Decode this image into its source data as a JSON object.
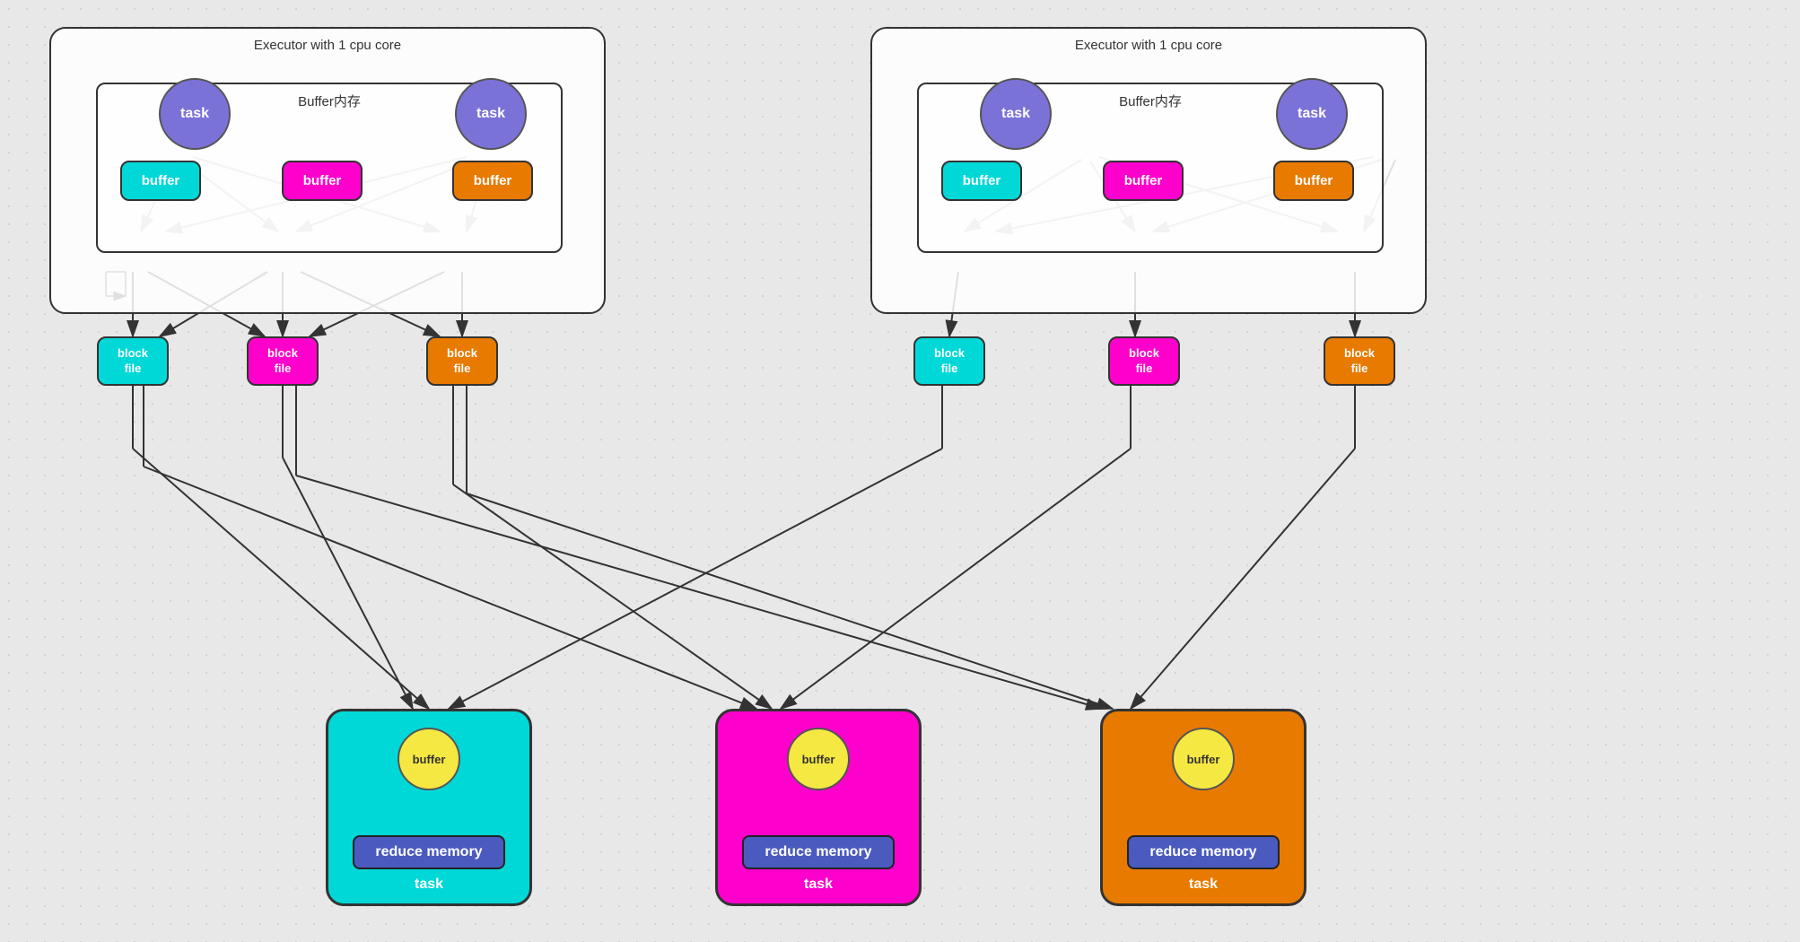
{
  "diagram": {
    "executor_label": "Executor with 1 cpu core",
    "buffer_inner_label": "Buffer内存",
    "task_label": "task",
    "buffer_label": "buffer",
    "block_file_label": "block\nfile",
    "reduce_memory_label": "reduce memory",
    "colors": {
      "cyan": "#00d8d8",
      "magenta": "#ff00cc",
      "orange": "#e87a00",
      "purple": "#7b72d8",
      "yellow": "#f5e842",
      "blue_btn": "#4a5abf"
    }
  }
}
